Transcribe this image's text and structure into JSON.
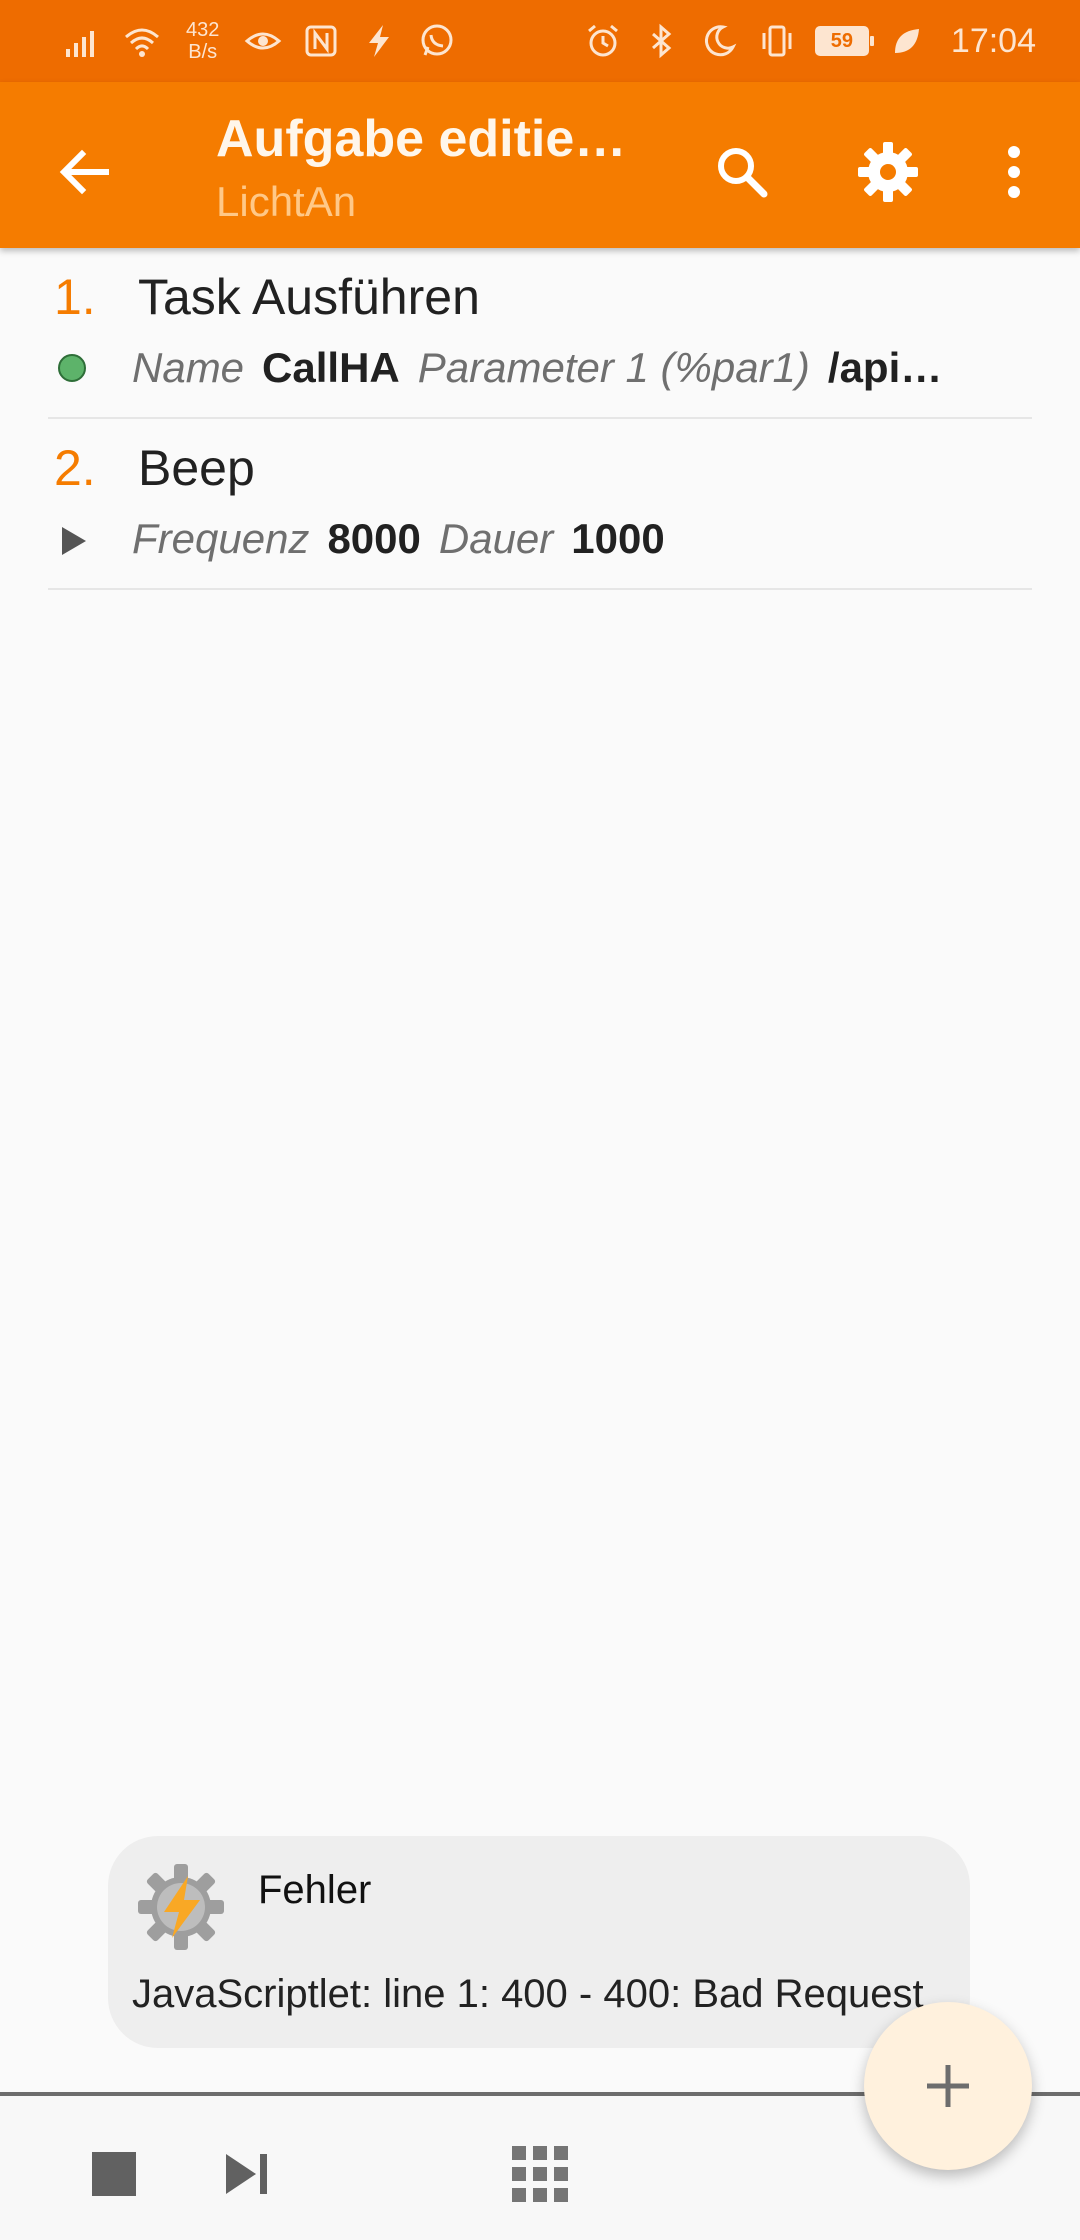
{
  "status_bar": {
    "net_speed_value": "432",
    "net_speed_unit": "B/s",
    "battery": "59",
    "time": "17:04",
    "icons_left": [
      "signal-icon",
      "wifi-icon",
      "eye-icon",
      "nfc-icon",
      "tasker-bolt-icon",
      "whatsapp-icon"
    ],
    "icons_right": [
      "alarm-icon",
      "bluetooth-icon",
      "moon-icon",
      "vibrate-icon",
      "battery-icon",
      "leaf-icon"
    ]
  },
  "app_bar": {
    "title": "Aufgabe editie…",
    "subtitle": "LichtAn",
    "color": "#f57c00"
  },
  "actions": [
    {
      "number": "1.",
      "name": "Task Ausführen",
      "indicator": "green-dot",
      "args": [
        {
          "label": "Name",
          "value": "CallHA"
        },
        {
          "label": "Parameter 1 (%par1)",
          "value": "/api…"
        }
      ]
    },
    {
      "number": "2.",
      "name": "Beep",
      "indicator": "play-triangle",
      "args": [
        {
          "label": "Frequenz",
          "value": "8000"
        },
        {
          "label": "Dauer",
          "value": "1000"
        }
      ]
    }
  ],
  "toast": {
    "title": "Fehler",
    "message": "JavaScriptlet: line 1: 400 - 400: Bad Request"
  },
  "bottom_bar": {
    "buttons": [
      "stop-icon",
      "step-forward-icon",
      "grid-icon"
    ]
  },
  "fab": {
    "icon": "plus-icon"
  }
}
